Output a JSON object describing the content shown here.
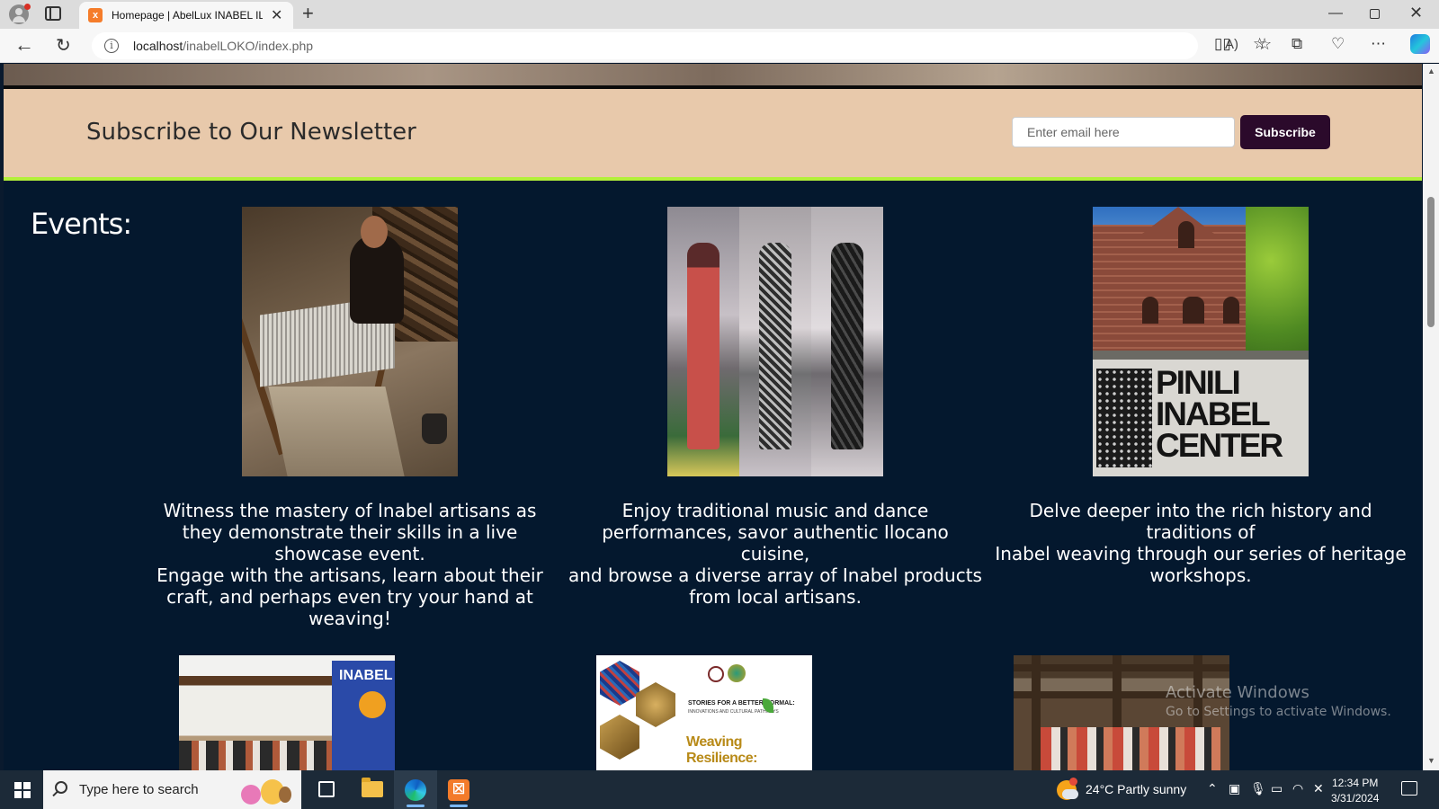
{
  "browser": {
    "tab_title": "Homepage | AbelLux INABEL ILO",
    "tab_favicon": "x",
    "url_host": "localhost",
    "url_path": "/inabelLOKO/index.php"
  },
  "newsletter": {
    "title": "Subscribe to Our Newsletter",
    "email_placeholder": "Enter email here",
    "subscribe_label": "Subscribe"
  },
  "events": {
    "heading": "Events:",
    "cards": [
      {
        "description": "Witness the mastery of Inabel artisans as they demonstrate their skills in a live showcase event.\nEngage with the artisans, learn about their craft, and perhaps even try your hand at weaving!"
      },
      {
        "description": "Enjoy traditional music and dance performances, savor authentic Ilocano cuisine,\nand browse a diverse array of Inabel products from local artisans."
      },
      {
        "description": "Delve deeper into the rich history and traditions of\nInabel weaving through our series of heritage workshops."
      }
    ],
    "sign_text": "PINILI INABEL CENTER",
    "banner_text": "INABEL",
    "poster_line1": "STORIES FOR A BETTER NORMAL:",
    "poster_line2": "INNOVATIONS AND CULTURAL PATHWAYS",
    "poster_title": "Weaving Resilience:"
  },
  "watermark": {
    "title": "Activate Windows",
    "subtitle": "Go to Settings to activate Windows."
  },
  "taskbar": {
    "search_placeholder": "Type here to search",
    "weather": "24°C  Partly sunny",
    "time": "12:34 PM",
    "date": "3/31/2024"
  }
}
